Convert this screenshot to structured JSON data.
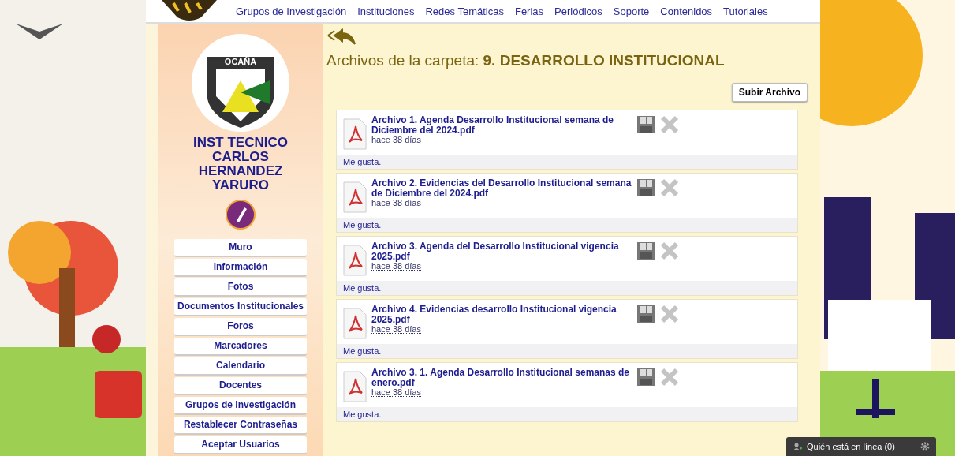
{
  "nav": {
    "items": [
      "Grupos de Investigación",
      "Instituciones",
      "Redes Temáticas",
      "Ferias",
      "Periódicos",
      "Soporte",
      "Contenidos",
      "Tutoriales"
    ]
  },
  "profile": {
    "name": "INST TECNICO CARLOS HERNANDEZ YARURO",
    "logo_text": "OCAÑA"
  },
  "sidebar": {
    "items": [
      {
        "label": "Muro"
      },
      {
        "label": "Información"
      },
      {
        "label": "Fotos"
      },
      {
        "label": "Documentos Institucionales"
      },
      {
        "label": "Foros"
      },
      {
        "label": "Marcadores"
      },
      {
        "label": "Calendario"
      },
      {
        "label": "Docentes"
      },
      {
        "label": "Grupos de investigación"
      },
      {
        "label": "Restablecer Contraseñas"
      },
      {
        "label": "Aceptar Usuarios"
      }
    ]
  },
  "folder": {
    "prefix": "Archivos de la carpeta:",
    "name": "9. DESARROLLO INSTITUCIONAL",
    "upload_button": "Subir Archivo"
  },
  "files": [
    {
      "title": "Archivo 1. Agenda Desarrollo Institucional semana de Diciembre del 2024.pdf",
      "age": "hace 38 días",
      "like": "Me gusta."
    },
    {
      "title": "Archivo 2. Evidencias del Desarrollo Institucional semana de Diciembre del 2024.pdf",
      "age": "hace 38 días",
      "like": "Me gusta."
    },
    {
      "title": "Archivo 3. Agenda del Desarrollo Institucional vigencia 2025.pdf",
      "age": "hace 38 días",
      "like": "Me gusta."
    },
    {
      "title": "Archivo 4. Evidencias desarrollo Institucional vigencia 2025.pdf",
      "age": "hace 38 días",
      "like": "Me gusta."
    },
    {
      "title": "Archivo 3. 1. Agenda Desarrollo Institucional semanas de enero.pdf",
      "age": "hace 38 días",
      "like": "Me gusta."
    }
  ],
  "online_bar": {
    "label": "Quién está en línea (0)"
  }
}
